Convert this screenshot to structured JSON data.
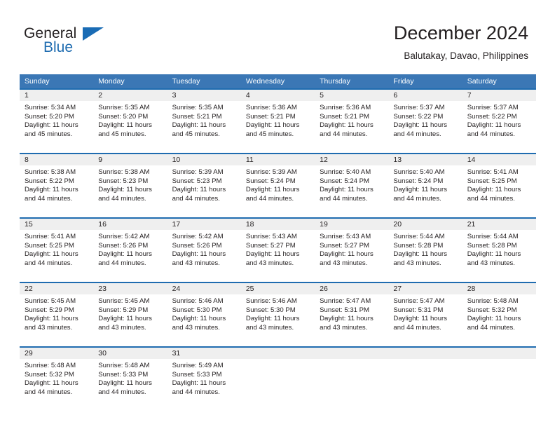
{
  "brand": {
    "name_part1": "General",
    "name_part2": "Blue"
  },
  "header": {
    "title": "December 2024",
    "location": "Balutakay, Davao, Philippines"
  },
  "colors": {
    "header_blue": "#3b77b5",
    "row_border_blue": "#1f6cb0",
    "day_band_gray": "#efefef",
    "text": "#231f20",
    "brand_blue": "#1f6cb0"
  },
  "weekdays": [
    "Sunday",
    "Monday",
    "Tuesday",
    "Wednesday",
    "Thursday",
    "Friday",
    "Saturday"
  ],
  "weeks": [
    [
      {
        "day": "1",
        "sunrise": "Sunrise: 5:34 AM",
        "sunset": "Sunset: 5:20 PM",
        "daylight_line1": "Daylight: 11 hours",
        "daylight_line2": "and 45 minutes."
      },
      {
        "day": "2",
        "sunrise": "Sunrise: 5:35 AM",
        "sunset": "Sunset: 5:20 PM",
        "daylight_line1": "Daylight: 11 hours",
        "daylight_line2": "and 45 minutes."
      },
      {
        "day": "3",
        "sunrise": "Sunrise: 5:35 AM",
        "sunset": "Sunset: 5:21 PM",
        "daylight_line1": "Daylight: 11 hours",
        "daylight_line2": "and 45 minutes."
      },
      {
        "day": "4",
        "sunrise": "Sunrise: 5:36 AM",
        "sunset": "Sunset: 5:21 PM",
        "daylight_line1": "Daylight: 11 hours",
        "daylight_line2": "and 45 minutes."
      },
      {
        "day": "5",
        "sunrise": "Sunrise: 5:36 AM",
        "sunset": "Sunset: 5:21 PM",
        "daylight_line1": "Daylight: 11 hours",
        "daylight_line2": "and 44 minutes."
      },
      {
        "day": "6",
        "sunrise": "Sunrise: 5:37 AM",
        "sunset": "Sunset: 5:22 PM",
        "daylight_line1": "Daylight: 11 hours",
        "daylight_line2": "and 44 minutes."
      },
      {
        "day": "7",
        "sunrise": "Sunrise: 5:37 AM",
        "sunset": "Sunset: 5:22 PM",
        "daylight_line1": "Daylight: 11 hours",
        "daylight_line2": "and 44 minutes."
      }
    ],
    [
      {
        "day": "8",
        "sunrise": "Sunrise: 5:38 AM",
        "sunset": "Sunset: 5:22 PM",
        "daylight_line1": "Daylight: 11 hours",
        "daylight_line2": "and 44 minutes."
      },
      {
        "day": "9",
        "sunrise": "Sunrise: 5:38 AM",
        "sunset": "Sunset: 5:23 PM",
        "daylight_line1": "Daylight: 11 hours",
        "daylight_line2": "and 44 minutes."
      },
      {
        "day": "10",
        "sunrise": "Sunrise: 5:39 AM",
        "sunset": "Sunset: 5:23 PM",
        "daylight_line1": "Daylight: 11 hours",
        "daylight_line2": "and 44 minutes."
      },
      {
        "day": "11",
        "sunrise": "Sunrise: 5:39 AM",
        "sunset": "Sunset: 5:24 PM",
        "daylight_line1": "Daylight: 11 hours",
        "daylight_line2": "and 44 minutes."
      },
      {
        "day": "12",
        "sunrise": "Sunrise: 5:40 AM",
        "sunset": "Sunset: 5:24 PM",
        "daylight_line1": "Daylight: 11 hours",
        "daylight_line2": "and 44 minutes."
      },
      {
        "day": "13",
        "sunrise": "Sunrise: 5:40 AM",
        "sunset": "Sunset: 5:24 PM",
        "daylight_line1": "Daylight: 11 hours",
        "daylight_line2": "and 44 minutes."
      },
      {
        "day": "14",
        "sunrise": "Sunrise: 5:41 AM",
        "sunset": "Sunset: 5:25 PM",
        "daylight_line1": "Daylight: 11 hours",
        "daylight_line2": "and 44 minutes."
      }
    ],
    [
      {
        "day": "15",
        "sunrise": "Sunrise: 5:41 AM",
        "sunset": "Sunset: 5:25 PM",
        "daylight_line1": "Daylight: 11 hours",
        "daylight_line2": "and 44 minutes."
      },
      {
        "day": "16",
        "sunrise": "Sunrise: 5:42 AM",
        "sunset": "Sunset: 5:26 PM",
        "daylight_line1": "Daylight: 11 hours",
        "daylight_line2": "and 44 minutes."
      },
      {
        "day": "17",
        "sunrise": "Sunrise: 5:42 AM",
        "sunset": "Sunset: 5:26 PM",
        "daylight_line1": "Daylight: 11 hours",
        "daylight_line2": "and 43 minutes."
      },
      {
        "day": "18",
        "sunrise": "Sunrise: 5:43 AM",
        "sunset": "Sunset: 5:27 PM",
        "daylight_line1": "Daylight: 11 hours",
        "daylight_line2": "and 43 minutes."
      },
      {
        "day": "19",
        "sunrise": "Sunrise: 5:43 AM",
        "sunset": "Sunset: 5:27 PM",
        "daylight_line1": "Daylight: 11 hours",
        "daylight_line2": "and 43 minutes."
      },
      {
        "day": "20",
        "sunrise": "Sunrise: 5:44 AM",
        "sunset": "Sunset: 5:28 PM",
        "daylight_line1": "Daylight: 11 hours",
        "daylight_line2": "and 43 minutes."
      },
      {
        "day": "21",
        "sunrise": "Sunrise: 5:44 AM",
        "sunset": "Sunset: 5:28 PM",
        "daylight_line1": "Daylight: 11 hours",
        "daylight_line2": "and 43 minutes."
      }
    ],
    [
      {
        "day": "22",
        "sunrise": "Sunrise: 5:45 AM",
        "sunset": "Sunset: 5:29 PM",
        "daylight_line1": "Daylight: 11 hours",
        "daylight_line2": "and 43 minutes."
      },
      {
        "day": "23",
        "sunrise": "Sunrise: 5:45 AM",
        "sunset": "Sunset: 5:29 PM",
        "daylight_line1": "Daylight: 11 hours",
        "daylight_line2": "and 43 minutes."
      },
      {
        "day": "24",
        "sunrise": "Sunrise: 5:46 AM",
        "sunset": "Sunset: 5:30 PM",
        "daylight_line1": "Daylight: 11 hours",
        "daylight_line2": "and 43 minutes."
      },
      {
        "day": "25",
        "sunrise": "Sunrise: 5:46 AM",
        "sunset": "Sunset: 5:30 PM",
        "daylight_line1": "Daylight: 11 hours",
        "daylight_line2": "and 43 minutes."
      },
      {
        "day": "26",
        "sunrise": "Sunrise: 5:47 AM",
        "sunset": "Sunset: 5:31 PM",
        "daylight_line1": "Daylight: 11 hours",
        "daylight_line2": "and 43 minutes."
      },
      {
        "day": "27",
        "sunrise": "Sunrise: 5:47 AM",
        "sunset": "Sunset: 5:31 PM",
        "daylight_line1": "Daylight: 11 hours",
        "daylight_line2": "and 44 minutes."
      },
      {
        "day": "28",
        "sunrise": "Sunrise: 5:48 AM",
        "sunset": "Sunset: 5:32 PM",
        "daylight_line1": "Daylight: 11 hours",
        "daylight_line2": "and 44 minutes."
      }
    ],
    [
      {
        "day": "29",
        "sunrise": "Sunrise: 5:48 AM",
        "sunset": "Sunset: 5:32 PM",
        "daylight_line1": "Daylight: 11 hours",
        "daylight_line2": "and 44 minutes."
      },
      {
        "day": "30",
        "sunrise": "Sunrise: 5:48 AM",
        "sunset": "Sunset: 5:33 PM",
        "daylight_line1": "Daylight: 11 hours",
        "daylight_line2": "and 44 minutes."
      },
      {
        "day": "31",
        "sunrise": "Sunrise: 5:49 AM",
        "sunset": "Sunset: 5:33 PM",
        "daylight_line1": "Daylight: 11 hours",
        "daylight_line2": "and 44 minutes."
      },
      {
        "day": "",
        "sunrise": "",
        "sunset": "",
        "daylight_line1": "",
        "daylight_line2": ""
      },
      {
        "day": "",
        "sunrise": "",
        "sunset": "",
        "daylight_line1": "",
        "daylight_line2": ""
      },
      {
        "day": "",
        "sunrise": "",
        "sunset": "",
        "daylight_line1": "",
        "daylight_line2": ""
      },
      {
        "day": "",
        "sunrise": "",
        "sunset": "",
        "daylight_line1": "",
        "daylight_line2": ""
      }
    ]
  ]
}
